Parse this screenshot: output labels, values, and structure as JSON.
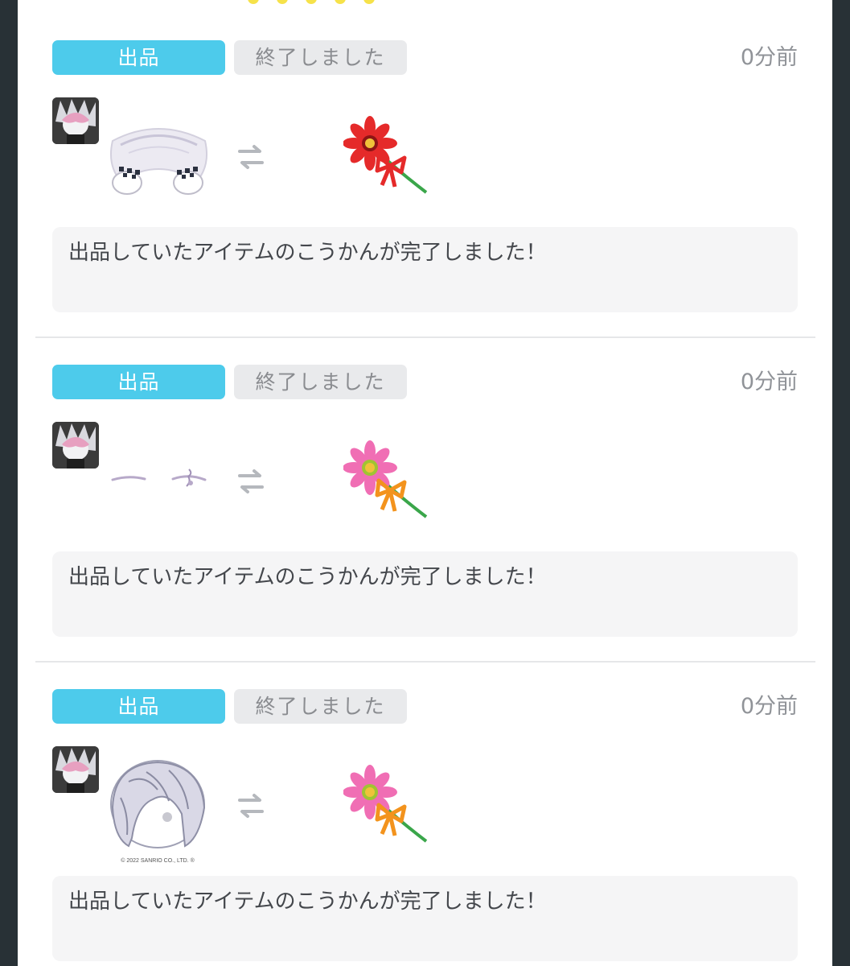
{
  "entries": [
    {
      "type_label": "出品",
      "status_label": "終了しました",
      "time": "0分前",
      "message": "出品していたアイテムのこうかんが完了しました！",
      "item": "fur-collar",
      "flower_color": "#e52a2a",
      "ribbon_color": "#e52a2a"
    },
    {
      "type_label": "出品",
      "status_label": "終了しました",
      "time": "0分前",
      "message": "出品していたアイテムのこうかんが完了しました！",
      "item": "eyebrows",
      "flower_color": "#f06eb4",
      "ribbon_color": "#f3931d"
    },
    {
      "type_label": "出品",
      "status_label": "終了しました",
      "time": "0分前",
      "message": "出品していたアイテムのこうかんが完了しました！",
      "item": "silver-hair",
      "copyright": "© 2022 SANRIO CO., LTD. ®",
      "flower_color": "#f06eb4",
      "ribbon_color": "#f3931d"
    }
  ],
  "icons": {
    "swap": "swap-arrows-icon",
    "flower": "gerbera-flower-icon",
    "avatar": "user-avatar"
  },
  "colors": {
    "accent": "#4dcbeb",
    "status_bg": "#e9eaec",
    "message_bg": "#f5f5f6"
  }
}
